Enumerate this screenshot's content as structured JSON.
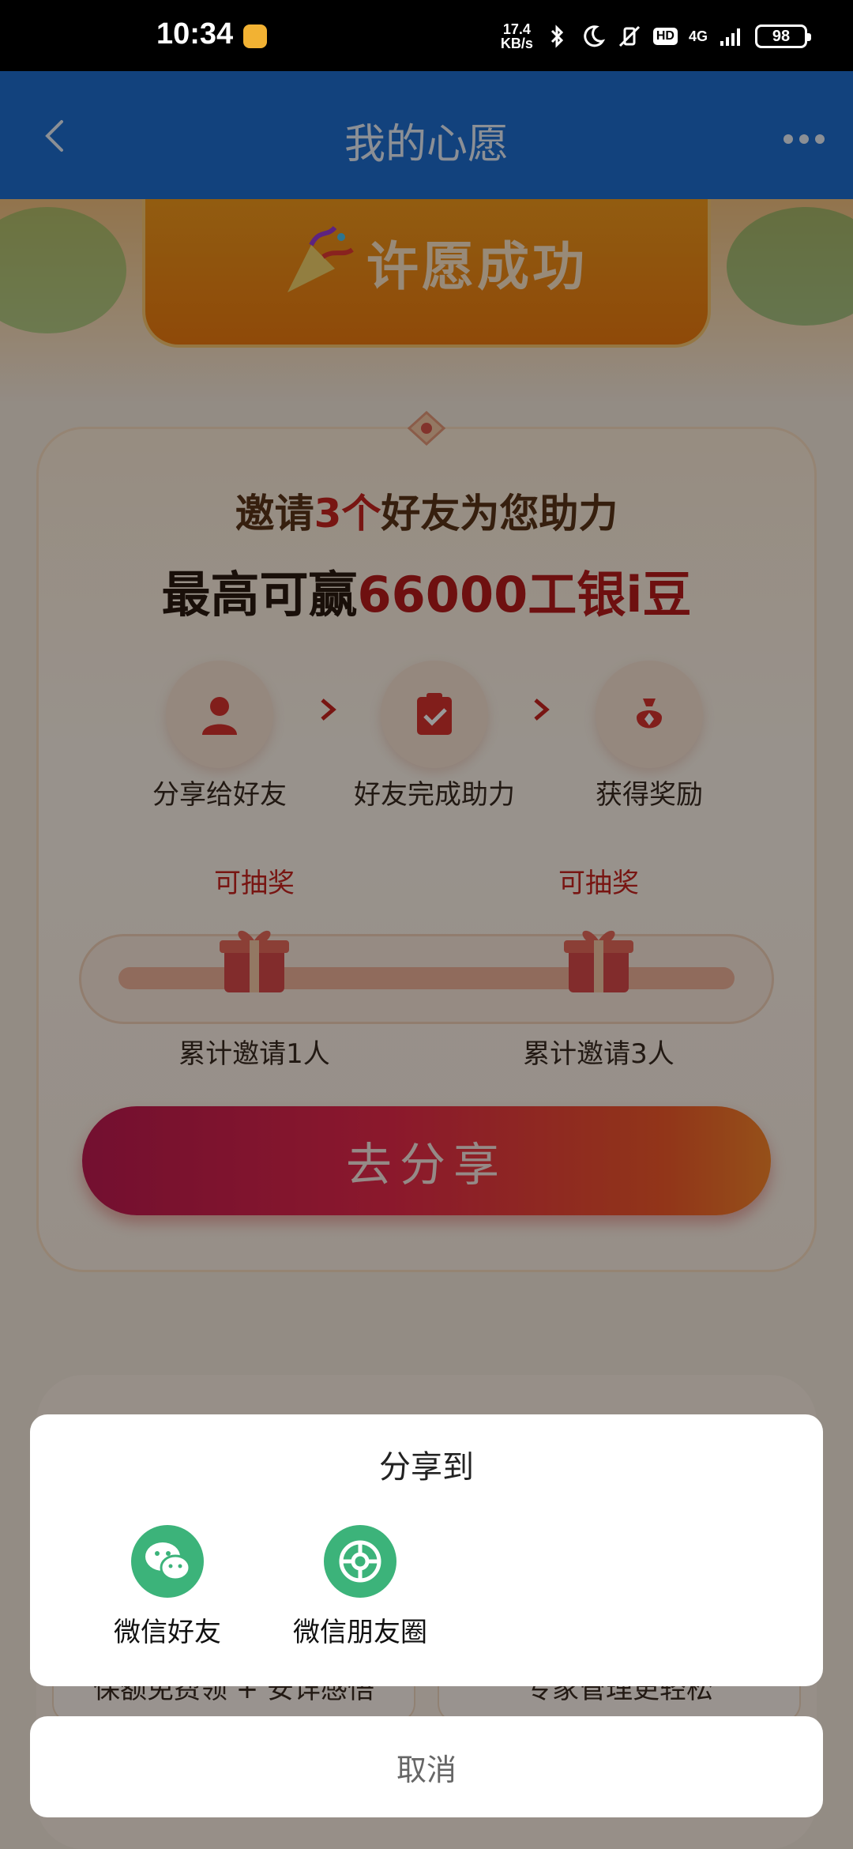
{
  "status_bar": {
    "time": "10:34",
    "net_speed_value": "17.4",
    "net_speed_unit": "KB/s",
    "network": "4G",
    "hd": "HD",
    "battery": "98"
  },
  "header": {
    "title": "我的心愿"
  },
  "banner": {
    "text": "许愿成功"
  },
  "invite": {
    "prefix": "邀请",
    "count": "3个",
    "suffix": "好友为您助力"
  },
  "reward": {
    "prefix": "最高可赢",
    "amount": "66000工银i豆"
  },
  "steps": [
    {
      "label": "分享给好友",
      "icon": "person-icon"
    },
    {
      "label": "好友完成助力",
      "icon": "clipboard-check-icon"
    },
    {
      "label": "获得奖励",
      "icon": "money-bag-icon"
    }
  ],
  "progress": {
    "milestones": [
      {
        "badge": "可抽奖",
        "label": "累计邀请1人"
      },
      {
        "badge": "可抽奖",
        "label": "累计邀请3人"
      }
    ]
  },
  "share_button": "去分享",
  "card2": {
    "left": "保额免费领 + 安详感悟",
    "right": "专家管理更轻松"
  },
  "share_sheet": {
    "title": "分享到",
    "options": [
      {
        "label": "微信好友",
        "icon": "wechat-icon"
      },
      {
        "label": "微信朋友圈",
        "icon": "wechat-moments-icon"
      }
    ],
    "cancel": "取消"
  },
  "colors": {
    "header_bg": "#1f6fd1",
    "accent_red": "#c8241f",
    "wechat_green": "#3cb37a",
    "banner_orange": "#ee7b0f"
  }
}
